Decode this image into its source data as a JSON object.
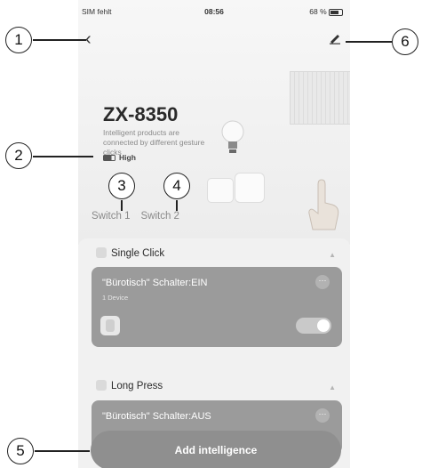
{
  "status": {
    "carrier": "SIM fehlt",
    "time": "08:56",
    "battery": "68 %"
  },
  "device": {
    "name": "ZX-8350",
    "description": "Intelligent products are connected by different gesture clicks",
    "battery_level": "High"
  },
  "tabs": [
    {
      "label": "Switch 1"
    },
    {
      "label": "Switch 2"
    }
  ],
  "sections": [
    {
      "title": "Single Click",
      "card_title": "\"Bürotisch\" Schalter:EIN",
      "card_sub": "1 Device"
    },
    {
      "title": "Long Press",
      "card_title": "\"Bürotisch\" Schalter:AUS"
    }
  ],
  "add_button": "Add intelligence",
  "callouts": [
    "1",
    "2",
    "3",
    "4",
    "5",
    "6"
  ]
}
